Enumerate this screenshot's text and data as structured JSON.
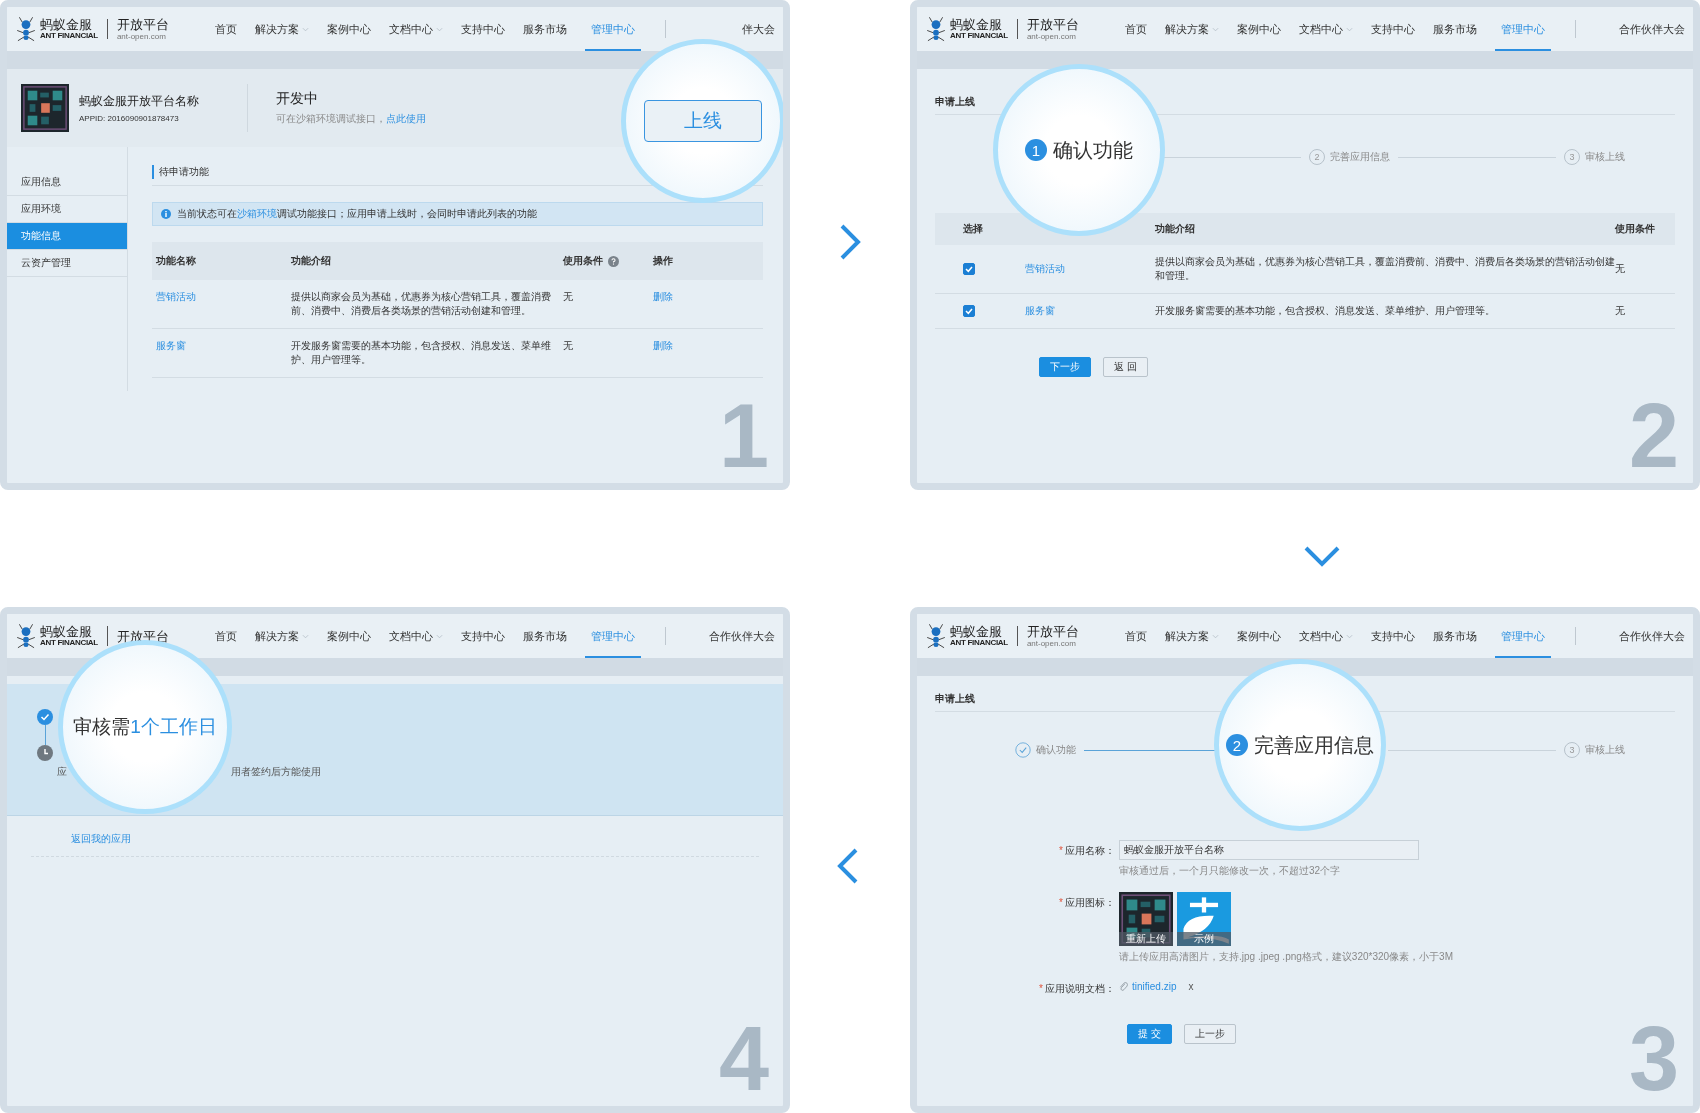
{
  "panels": [
    {
      "kind": "app_detail",
      "step_number": "1",
      "nav": {
        "brand": "蚂蚁金服",
        "brand_sub": "ANT FINANCIAL",
        "product": "开放平台",
        "product_sub": "ant-open.com",
        "items": [
          {
            "label": "首页",
            "dropdown": false,
            "selected": false
          },
          {
            "label": "解决方案",
            "dropdown": true,
            "selected": false
          },
          {
            "label": "案例中心",
            "dropdown": false,
            "selected": false
          },
          {
            "label": "文档中心",
            "dropdown": true,
            "selected": false
          },
          {
            "label": "支持中心",
            "dropdown": false,
            "selected": false
          },
          {
            "label": "服务市场",
            "dropdown": false,
            "selected": false
          },
          {
            "label": "管理中心",
            "dropdown": false,
            "selected": true
          }
        ],
        "extra": "伴大会"
      },
      "app": {
        "name": "蚂蚁金服开放平台名称",
        "appid": "APPID: 2016090901878473",
        "status": "开发中",
        "hint": "可在沙箱环境调试接口，",
        "hint_link": "点此使用"
      },
      "magnifier": {
        "label": "上线"
      },
      "sidebar": [
        {
          "label": "应用信息",
          "selected": false
        },
        {
          "label": "应用环境",
          "selected": false
        },
        {
          "label": "功能信息",
          "selected": true
        },
        {
          "label": "云资产管理",
          "selected": false
        }
      ],
      "section_title": "待申请功能",
      "info": {
        "before": "当前状态可在",
        "link": "沙箱环境",
        "after": "调试功能接口；应用申请上线时，会同时申请此列表的功能"
      },
      "table": {
        "columns": [
          "功能名称",
          "功能介绍",
          "使用条件",
          "操作"
        ],
        "rows": [
          {
            "name": "营销活动",
            "description": "提供以商家会员为基础，优惠券为核心营销工具，覆盖消费前、消费中、消费后各类场景的营销活动创建和管理。",
            "condition": "无",
            "action": "删除"
          },
          {
            "name": "服务窗",
            "description": "开发服务窗需要的基本功能，包含授权、消息发送、菜单维护、用户管理等。",
            "condition": "无",
            "action": "删除"
          }
        ]
      }
    },
    {
      "kind": "confirm",
      "step_number": "2",
      "nav": {
        "brand": "蚂蚁金服",
        "brand_sub": "ANT FINANCIAL",
        "product": "开放平台",
        "product_sub": "ant-open.com",
        "items": [
          {
            "label": "首页",
            "dropdown": false,
            "selected": false
          },
          {
            "label": "解决方案",
            "dropdown": true,
            "selected": false
          },
          {
            "label": "案例中心",
            "dropdown": false,
            "selected": false
          },
          {
            "label": "文档中心",
            "dropdown": true,
            "selected": false
          },
          {
            "label": "支持中心",
            "dropdown": false,
            "selected": false
          },
          {
            "label": "服务市场",
            "dropdown": false,
            "selected": false
          },
          {
            "label": "管理中心",
            "dropdown": false,
            "selected": true
          }
        ],
        "extra": "合作伙伴大会"
      },
      "title": "申请上线",
      "steps": [
        {
          "number": "1",
          "label": "确认功能",
          "done": false,
          "current": true
        },
        {
          "number": "2",
          "label": "完善应用信息",
          "done": false,
          "current": false
        },
        {
          "number": "3",
          "label": "审核上线",
          "done": false,
          "current": false
        }
      ],
      "table": {
        "columns": [
          "选择",
          "功能介绍",
          "使用条件"
        ],
        "rows": [
          {
            "checked": true,
            "name": "营销活动",
            "description": "提供以商家会员为基础，优惠券为核心营销工具，覆盖消费前、消费中、消费后各类场景的营销活动创建和管理。",
            "condition": "无"
          },
          {
            "checked": true,
            "name": "服务窗",
            "description": "开发服务窗需要的基本功能，包含授权、消息发送、菜单维护、用户管理等。",
            "condition": "无"
          }
        ]
      },
      "buttons": [
        {
          "label": "下一步",
          "primary": true
        },
        {
          "label": "返 回",
          "primary": false
        }
      ]
    },
    {
      "kind": "review",
      "step_number": "4",
      "nav": {
        "brand": "蚂蚁金服",
        "brand_sub": "ANT FINANCIAL",
        "product": "开放平台",
        "items": [
          {
            "label": "首页",
            "dropdown": false,
            "selected": false
          },
          {
            "label": "解决方案",
            "dropdown": true,
            "selected": false
          },
          {
            "label": "案例中心",
            "dropdown": false,
            "selected": false
          },
          {
            "label": "文档中心",
            "dropdown": true,
            "selected": false
          },
          {
            "label": "支持中心",
            "dropdown": false,
            "selected": false
          },
          {
            "label": "服务市场",
            "dropdown": false,
            "selected": false
          },
          {
            "label": "管理中心",
            "dropdown": false,
            "selected": true
          }
        ],
        "extra": "合作伙伴大会"
      },
      "message": "审核需**1个工作日**",
      "timeline": [
        {
          "done": true
        },
        {
          "done": false
        }
      ],
      "caption_parts": [
        "应",
        "用者签约后方能使用"
      ],
      "link": "返回我的应用"
    },
    {
      "kind": "info_form",
      "step_number": "3",
      "nav": {
        "brand": "蚂蚁金服",
        "brand_sub": "ANT FINANCIAL",
        "product": "开放平台",
        "product_sub": "ant-open.com",
        "items": [
          {
            "label": "首页",
            "dropdown": false,
            "selected": false
          },
          {
            "label": "解决方案",
            "dropdown": true,
            "selected": false
          },
          {
            "label": "案例中心",
            "dropdown": false,
            "selected": false
          },
          {
            "label": "文档中心",
            "dropdown": true,
            "selected": false
          },
          {
            "label": "支持中心",
            "dropdown": false,
            "selected": false
          },
          {
            "label": "服务市场",
            "dropdown": false,
            "selected": false
          },
          {
            "label": "管理中心",
            "dropdown": false,
            "selected": true
          }
        ],
        "extra": "合作伙伴大会"
      },
      "title": "申请上线",
      "steps": [
        {
          "label": "确认功能",
          "done": true,
          "current": false
        },
        {
          "number": "2",
          "label": "完善应用信息",
          "done": false,
          "current": true
        },
        {
          "number": "3",
          "label": "审核上线",
          "done": false,
          "current": false
        }
      ],
      "fields": [
        {
          "kind": "text",
          "mark": "*",
          "label": "应用名称：",
          "value": "蚂蚁金服开放平台名称",
          "hint": "审核通过后，一个月只能修改一次，不超过32个字"
        },
        {
          "kind": "images",
          "mark": "*",
          "label": "应用图标：",
          "images": [
            {
              "caption": "重新上传"
            },
            {
              "caption": "示例"
            }
          ],
          "hint": "请上传应用高清图片，支持.jpg .jpeg .png格式，建议320*320像素，小于3M"
        },
        {
          "kind": "file",
          "mark": "*",
          "label": "应用说明文档：",
          "file": "tinified.zip",
          "remove": "x"
        }
      ],
      "buttons": [
        {
          "label": "提 交",
          "primary": true
        },
        {
          "label": "上一步",
          "primary": false
        }
      ]
    }
  ]
}
